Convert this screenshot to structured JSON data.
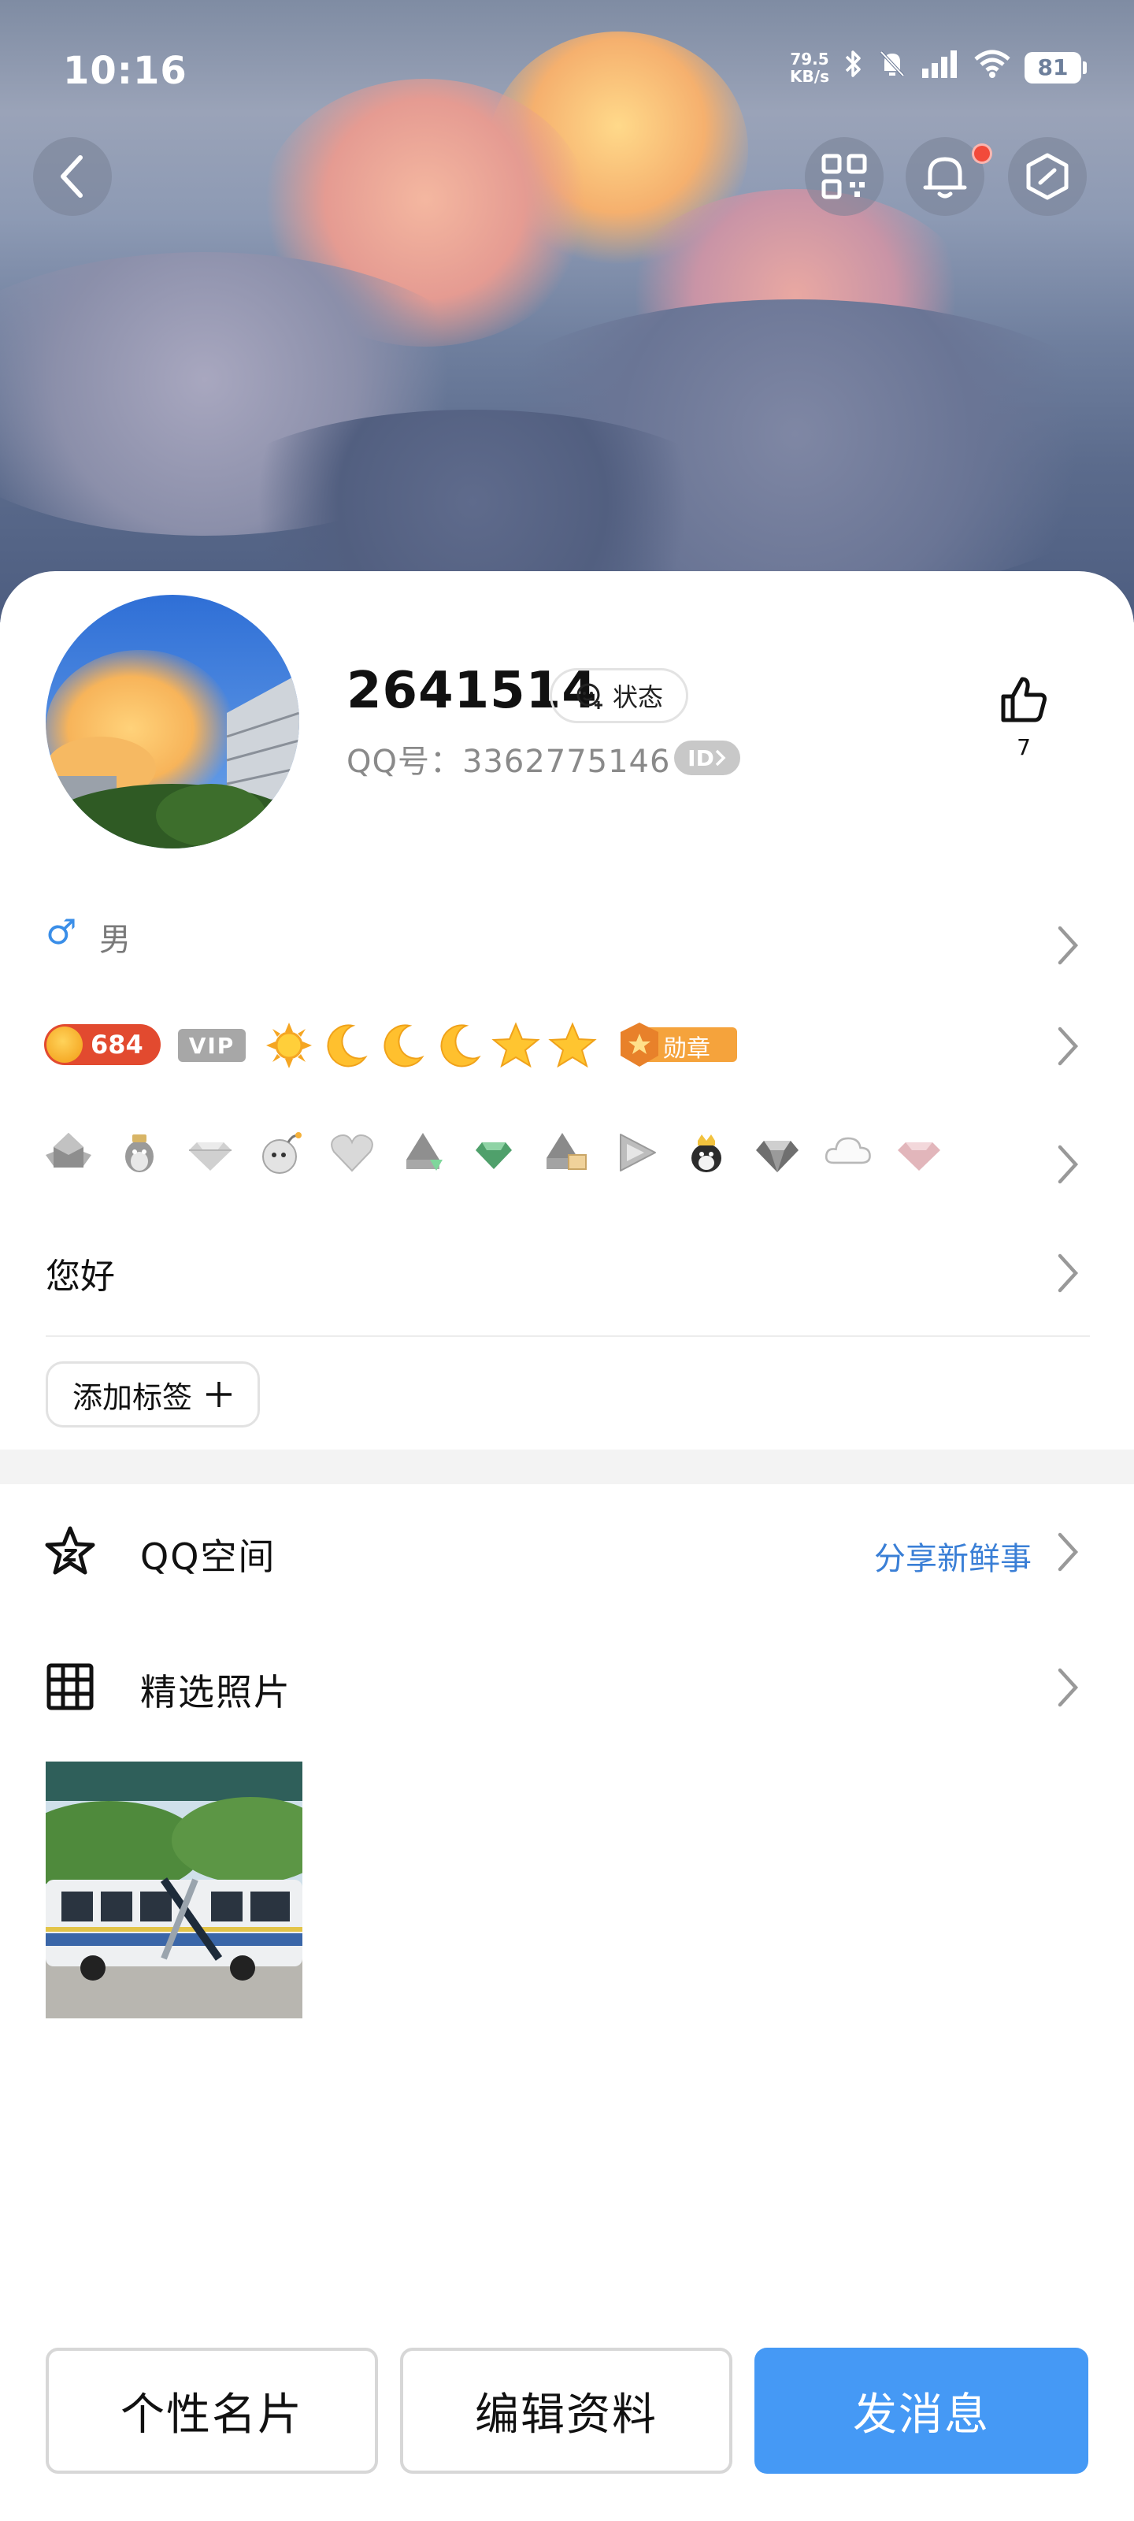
{
  "status_bar": {
    "time": "10:16",
    "net_speed_value": "79.5",
    "net_speed_unit": "KB/s",
    "battery": "81"
  },
  "profile": {
    "name": "2641514",
    "status_label": "状态",
    "qq_number": "QQ号：3362775146",
    "id_badge": "ID",
    "likes": "7",
    "gender": "男",
    "level_value": "684",
    "vip_label": "VIP",
    "medal_label": "勋章",
    "signature": "您好",
    "add_tag_label": "添加标签"
  },
  "sections": {
    "qzone_title": "QQ空间",
    "qzone_action": "分享新鲜事",
    "photos_title": "精选照片"
  },
  "bottom_bar": {
    "card_label": "个性名片",
    "edit_label": "编辑资料",
    "message_label": "发消息"
  },
  "colors": {
    "accent_blue": "#4599f5",
    "link_blue": "#3a7fd6",
    "level_red": "#e24a2f",
    "notification_red": "#f24a3a"
  },
  "icons": {
    "level_stars": [
      "sun-icon",
      "moon-icon",
      "moon-icon",
      "moon-icon",
      "star-icon",
      "star-icon"
    ],
    "badges": [
      "penguin-grey-icon",
      "penguin-hat-icon",
      "diamond-icon",
      "penguin-bomb-icon",
      "heart-icon",
      "penguin-gem-icon",
      "emerald-icon",
      "penguin-book-icon",
      "play-icon",
      "penguin-crown-icon",
      "diamond-dark-icon",
      "cloud-icon",
      "diamond-pink-icon"
    ]
  }
}
